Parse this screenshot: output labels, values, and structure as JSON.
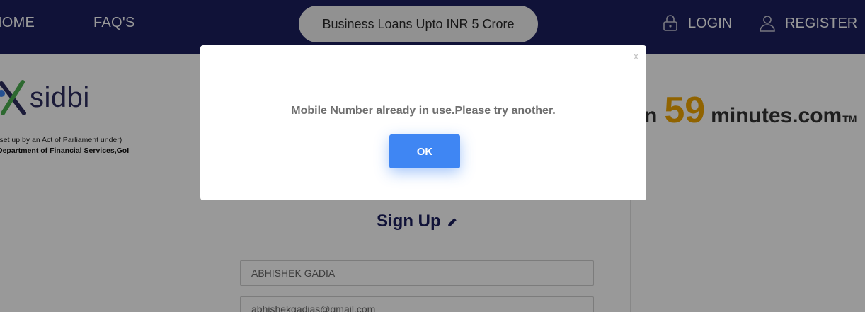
{
  "nav": {
    "home_label": "HOME",
    "faq_label": "FAQ'S",
    "promo_label": "Business Loans Upto INR 5 Crore",
    "login_label": "LOGIN",
    "register_label": "REGISTER",
    "login_icon": "lock-icon",
    "register_icon": "user-icon"
  },
  "logo": {
    "wordmark": "sidbi",
    "line1": "(set up by an Act of Parliament under)",
    "line2": "Department of Financial Services,GoI"
  },
  "brand": {
    "prefix": "n",
    "number": "59",
    "suffix": "minutes.com",
    "tm": "TM",
    "accent_color": "#f0a500"
  },
  "form": {
    "title": "Sign Up",
    "name_value": "ABHISHEK GADIA",
    "email_value": "abhishekgadias@gmail.com"
  },
  "modal": {
    "close_label": "x",
    "message": "Mobile Number already in use.Please try another.",
    "ok_label": "OK",
    "button_color": "#3f86f3"
  },
  "colors": {
    "nav_background": "#1c1f5e",
    "overlay": "rgba(0,0,0,0.4)"
  }
}
